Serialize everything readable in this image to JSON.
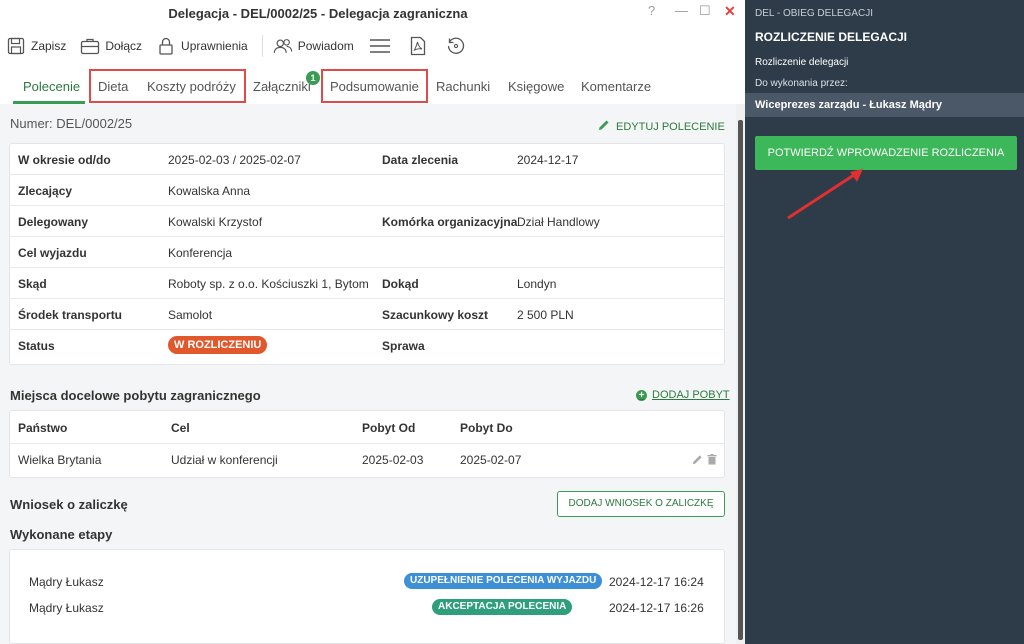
{
  "window": {
    "title": "Delegacja - DEL/0002/25 - Delegacja zagraniczna",
    "help": "?",
    "minimize": "—",
    "maximize": "☐",
    "close": "✕"
  },
  "toolbar": {
    "save": "Zapisz",
    "attach": "Dołącz",
    "permissions": "Uprawnienia",
    "notify": "Powiadom"
  },
  "tabs": [
    {
      "label": "Polecenie",
      "active": true
    },
    {
      "label": "Dieta"
    },
    {
      "label": "Koszty podróży"
    },
    {
      "label": "Załączniki",
      "badge": "1"
    },
    {
      "label": "Podsumowanie"
    },
    {
      "label": "Rachunki"
    },
    {
      "label": "Księgowe"
    },
    {
      "label": "Komentarze"
    }
  ],
  "header": {
    "numer": "Numer: DEL/0002/25",
    "edit_label": "EDYTUJ POLECENIE"
  },
  "info": {
    "period_label": "W okresie od/do",
    "period_value": "2025-02-03 / 2025-02-07",
    "order_date_label": "Data zlecenia",
    "order_date_value": "2024-12-17",
    "zlecajacy_label": "Zlecający",
    "zlecajacy_value": "Kowalska Anna",
    "delegowany_label": "Delegowany",
    "delegowany_value": "Kowalski Krzystof",
    "komorka_label": "Komórka organizacyjna",
    "komorka_value": "Dział Handlowy",
    "cel_label": "Cel wyjazdu",
    "cel_value": "Konferencja",
    "skad_label": "Skąd",
    "skad_value": "Roboty sp. z o.o. Kościuszki 1, Bytom",
    "dokad_label": "Dokąd",
    "dokad_value": "Londyn",
    "transport_label": "Środek transportu",
    "transport_value": "Samolot",
    "koszt_label": "Szacunkowy koszt",
    "koszt_value": "2 500 PLN",
    "status_label": "Status",
    "status_value": "W ROZLICZENIU",
    "sprawa_label": "Sprawa"
  },
  "pobyt": {
    "title": "Miejsca docelowe pobytu zagranicznego",
    "add_label": "DODAJ POBYT",
    "columns": [
      "Państwo",
      "Cel",
      "Pobyt Od",
      "Pobyt Do"
    ],
    "rows": [
      [
        "Wielka Brytania",
        "Udział w konferencji",
        "2025-02-03",
        "2025-02-07"
      ]
    ]
  },
  "zaliczka": {
    "title": "Wniosek o zaliczkę",
    "button": "DODAJ WNIOSEK O ZALICZKĘ"
  },
  "etapy": {
    "title": "Wykonane etapy",
    "items": [
      {
        "name": "Mądry Łukasz",
        "badge": "UZUPEŁNIENIE POLECENIA WYJAZDU",
        "time": "2024-12-17 16:24",
        "color": "#3d8fd6"
      },
      {
        "name": "Mądry Łukasz",
        "badge": "AKCEPTACJA POLECENIA",
        "time": "2024-12-17 16:26",
        "color": "#2e9e7c"
      }
    ]
  },
  "side": {
    "header": "DEL - OBIEG DELEGACJI",
    "title": "ROZLICZENIE DELEGACJI",
    "subtitle": "Rozliczenie delegacji",
    "assignee_label": "Do wykonania przez:",
    "assignee": "Wiceprezes zarządu - Łukasz Mądry",
    "confirm_button": "POTWIERDŹ WPROWADZENIE ROZLICZENIA"
  },
  "colors": {
    "accent": "#3a9b52",
    "status": "#e0582b",
    "panel": "#2e3b49",
    "highlight": "#e04a4a"
  }
}
